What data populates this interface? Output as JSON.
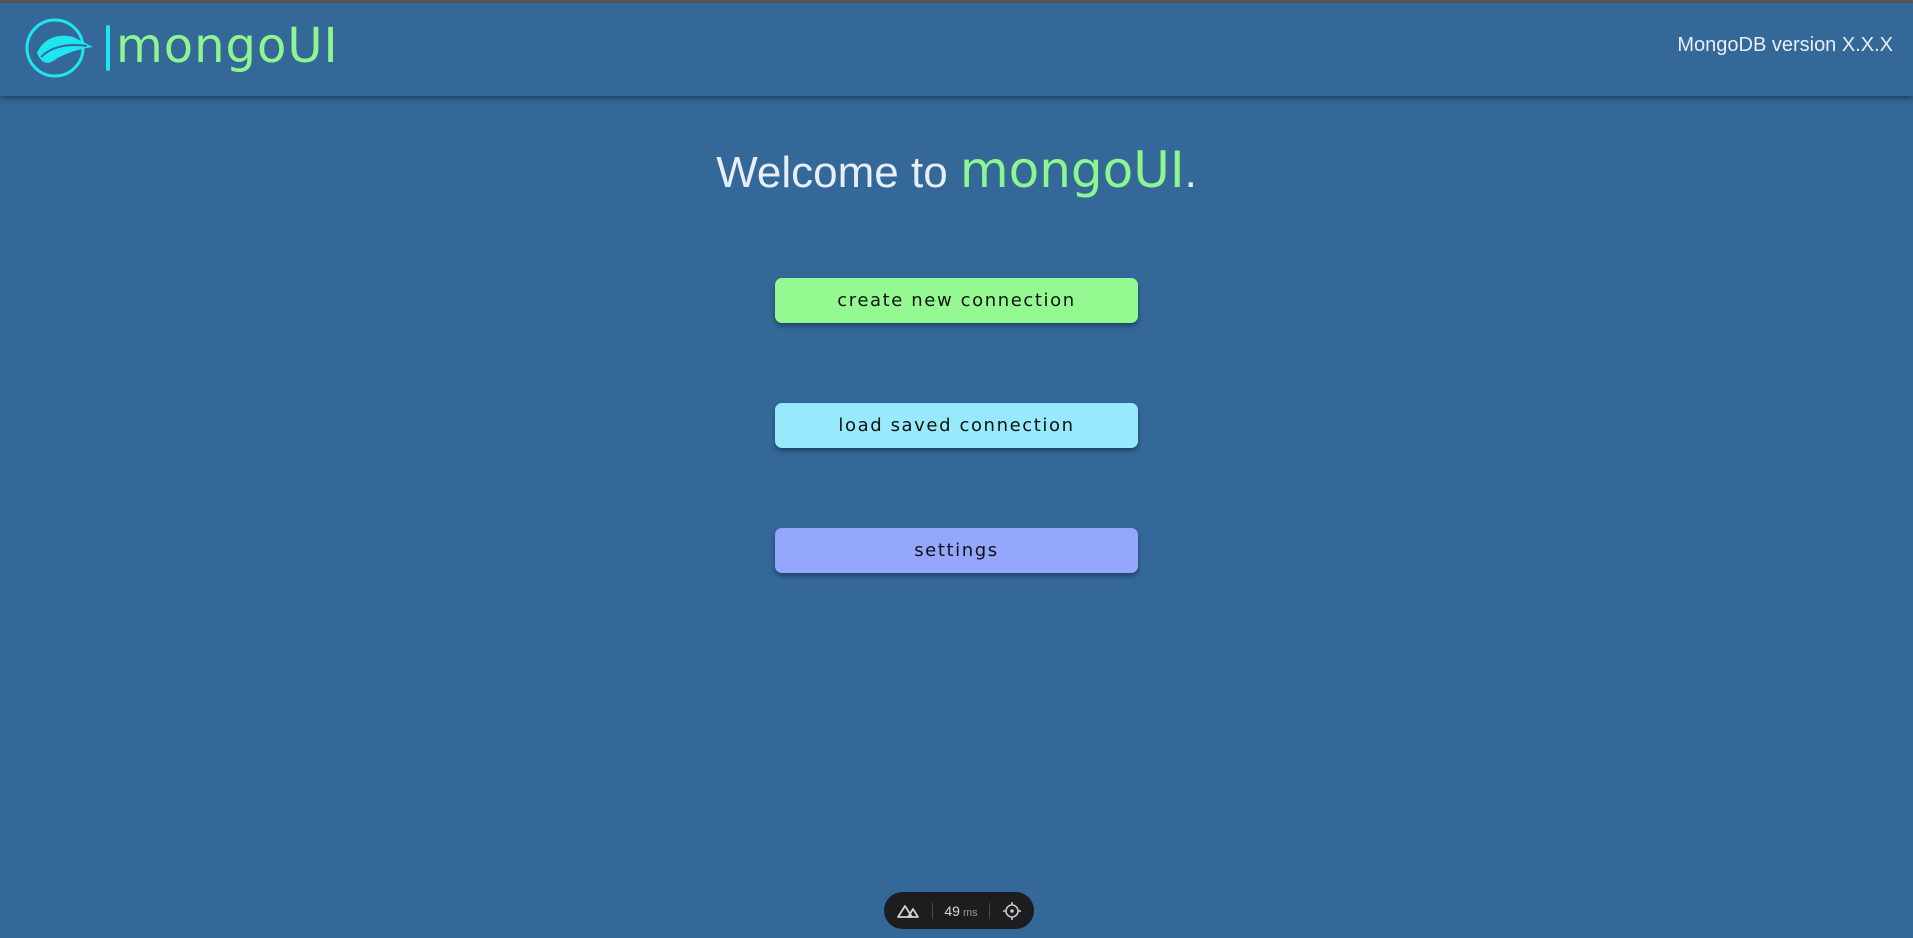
{
  "header": {
    "app_name": "mongoUI",
    "version_text": "MongoDB version X.X.X"
  },
  "welcome": {
    "prefix": "Welcome to ",
    "brand": "mongoUI",
    "suffix": "."
  },
  "actions": {
    "create_label": "create new connection",
    "load_label": "load saved connection",
    "settings_label": "settings"
  },
  "devtools": {
    "render_time": "49",
    "render_unit": "ms"
  },
  "colors": {
    "background": "#336899",
    "brand_green": "#8ff68f",
    "logo_cyan": "#1ee6f0",
    "create_button": "#95f992",
    "load_button": "#96eafc",
    "settings_button": "#95a7fd"
  },
  "icons": {
    "logo": "leaf-circle-logo",
    "devtools_logo": "nuxt-icon",
    "inspect": "crosshair-icon"
  }
}
